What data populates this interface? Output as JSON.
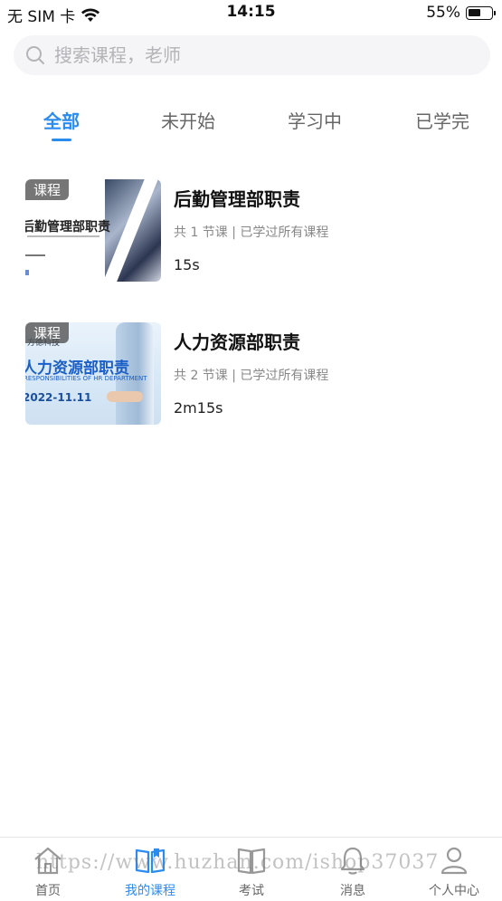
{
  "status_bar": {
    "carrier": "无 SIM 卡",
    "time": "14:15",
    "battery_percent": "55%",
    "battery_level": 0.55
  },
  "search": {
    "placeholder": "搜索课程，老师",
    "value": ""
  },
  "tabs": [
    {
      "label": "全部",
      "active": true
    },
    {
      "label": "未开始",
      "active": false
    },
    {
      "label": "学习中",
      "active": false
    },
    {
      "label": "已学完",
      "active": false
    }
  ],
  "courses": [
    {
      "badge": "课程",
      "title": "后勤管理部职责",
      "meta": "共 1 节课 | 已学过所有课程",
      "duration": "15s",
      "thumb_title": "后勤管理部职责"
    },
    {
      "badge": "课程",
      "title": "人力资源部职责",
      "meta": "共 2 节课 | 已学过所有课程",
      "duration": "2m15s",
      "thumb_logo": "方德科技",
      "thumb_title": "人力资源部职责",
      "thumb_subtitle": "RESPONSIBILITIES OF HR DEPARTMENT",
      "thumb_date": "2022-11.11"
    }
  ],
  "tabbar": [
    {
      "label": "首页",
      "icon": "home-icon",
      "active": false
    },
    {
      "label": "我的课程",
      "icon": "open-book-icon",
      "active": true
    },
    {
      "label": "考试",
      "icon": "book-icon",
      "active": false
    },
    {
      "label": "消息",
      "icon": "bell-icon",
      "active": false
    },
    {
      "label": "个人中心",
      "icon": "person-icon",
      "active": false
    }
  ],
  "watermark": "https://www.huzhan.com/ishop37037",
  "colors": {
    "accent": "#2b8cf0",
    "muted_text": "#888888",
    "search_bg": "#f5f5f7"
  }
}
